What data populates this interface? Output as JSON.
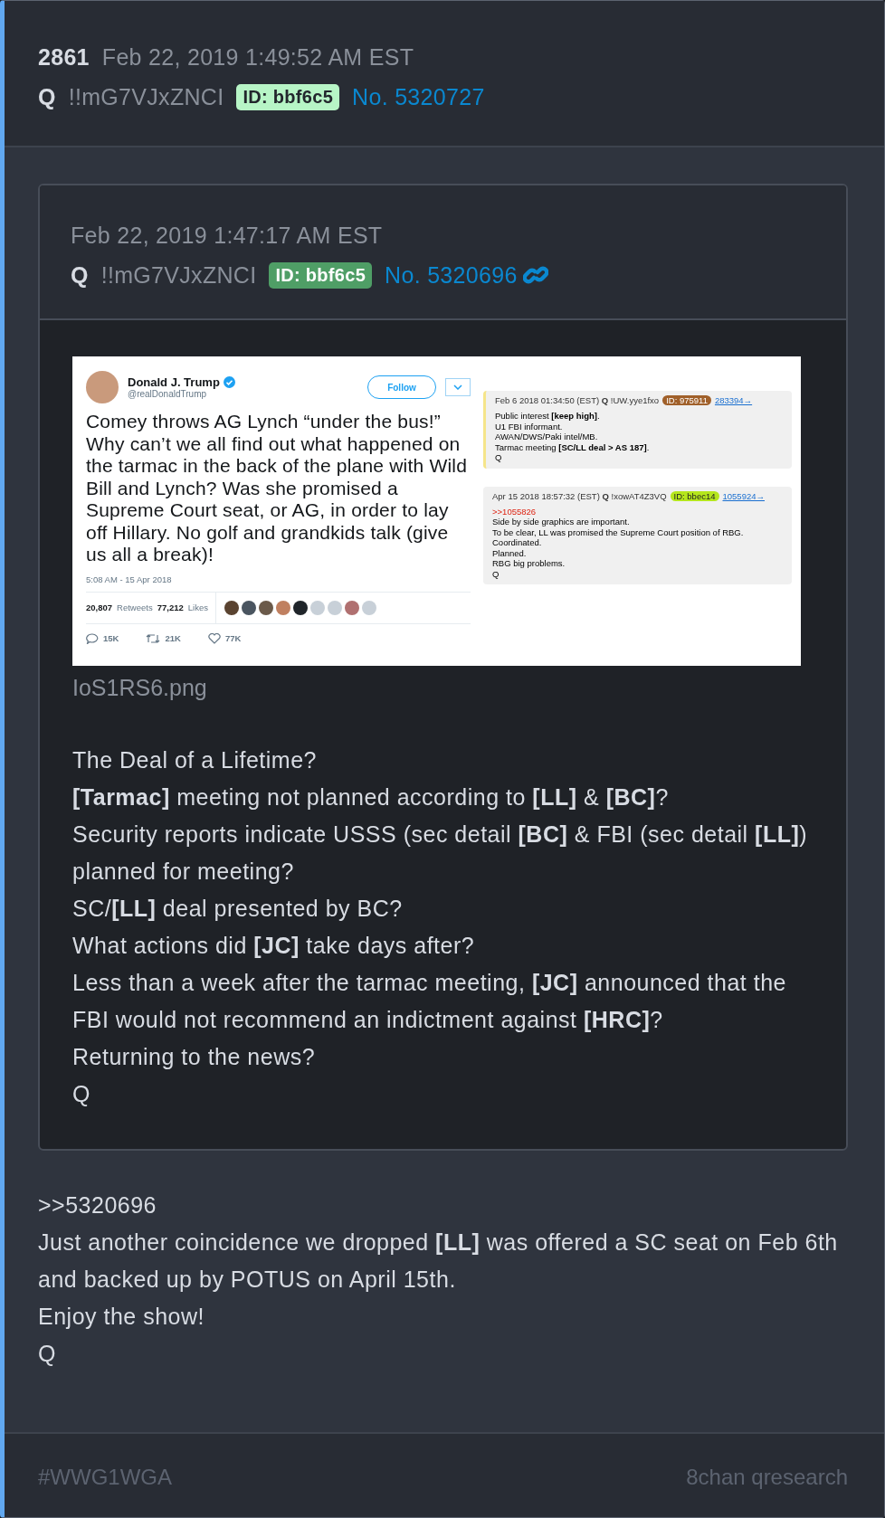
{
  "post": {
    "number": "2861",
    "date": "Feb 22, 2019 1:49:52 AM EST",
    "name": "Q",
    "tripcode": "!!mG7VJxZNCI",
    "id_badge": "ID: bbf6c5",
    "post_link": "No. 5320727"
  },
  "quoted_post": {
    "date": "Feb 22, 2019 1:47:17 AM EST",
    "name": "Q",
    "tripcode": "!!mG7VJxZNCI",
    "id_badge": "ID: bbf6c5",
    "post_link": "No. 5320696",
    "image": {
      "tweet": {
        "display_name": "Donald J. Trump",
        "handle": "@realDonaldTrump",
        "follow_button": "Follow",
        "text": "Comey throws AG Lynch “under the bus!” Why can’t we all find out what happened on the tarmac in the back of the plane with Wild Bill and Lynch? Was she promised a Supreme Court seat, or AG, in order to lay off Hillary. No golf and grandkids talk (give us all a break)!",
        "timestamp": "5:08 AM - 15 Apr 2018",
        "retweets_count": "20,807",
        "retweets_label": "Retweets",
        "likes_count": "77,212",
        "likes_label": "Likes",
        "reply_count": "15K",
        "retweet_count": "21K",
        "like_count": "77K"
      },
      "posts": [
        {
          "header": "Feb 6 2018 01:34:50 (EST) **Q** !UW.yye1fxo",
          "id_badge": "ID: 975911",
          "color": "#a0602a",
          "link": "283394→",
          "highlighted": true,
          "lines": [
            "Public interest **[keep high]**.",
            "U1 FBI informant.",
            "AWAN/DWS/Paki intel/MB.",
            "Tarmac meeting **[SC/LL deal > AS 187]**.",
            "Q"
          ]
        },
        {
          "header": "Apr 15 2018 18:57:32 (EST) **Q** !xowAT4Z3VQ",
          "id_badge": "ID: bbec14",
          "color": "#b5e61d",
          "link": "1055924→",
          "highlighted": false,
          "reference": ">>1055826",
          "lines": [
            "Side by side graphics are important.",
            "To be clear, LL was promised the Supreme Court position of RBG.",
            "Coordinated.",
            "Planned.",
            "RBG big problems.",
            "Q"
          ]
        }
      ]
    },
    "filename": "IoS1RS6.png",
    "lines": [
      "The Deal of a Lifetime?",
      "**[Tarmac]** meeting not planned according to **[LL]** & **[BC]**?",
      "Security reports indicate USSS (sec detail **[BC]** & FBI (sec detail **[LL]**) planned for meeting?",
      "SC/**[LL]** deal presented by BC?",
      "What actions did **[JC]** take days after?",
      "Less than a week after the tarmac meeting, **[JC]** announced that the FBI would not recommend an indictment against **[HRC]**?",
      "Returning to the news?",
      "Q"
    ]
  },
  "reply_lines": [
    ">>5320696",
    "Just another coincidence we dropped **[LL]** was offered a SC seat on Feb 6th and backed up by POTUS on April 15th.",
    "Enjoy the show!",
    "Q"
  ],
  "footer": {
    "hashtag": "#WWG1WGA",
    "source": "8chan qresearch"
  }
}
